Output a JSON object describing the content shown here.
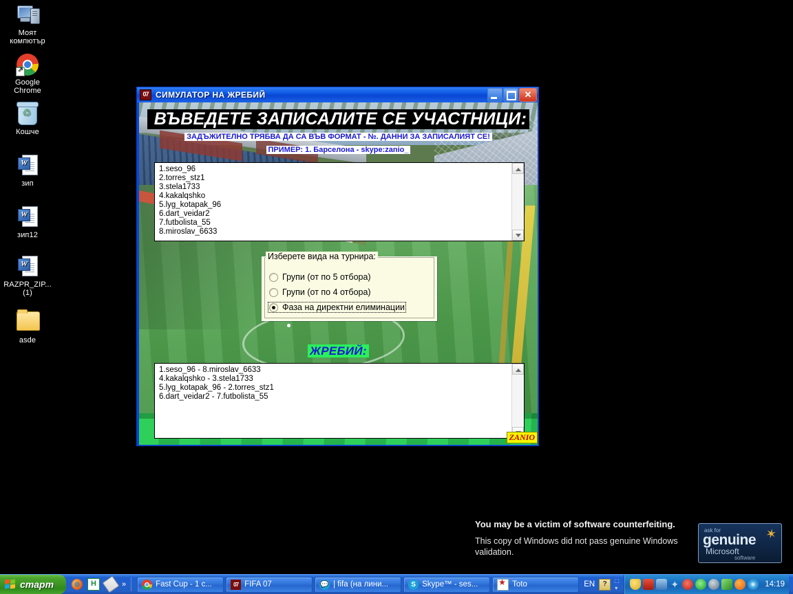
{
  "desktop": {
    "icons": [
      {
        "label": "Моят компютър",
        "icon": "my-computer-icon"
      },
      {
        "label": "Google Chrome",
        "icon": "chrome-icon"
      },
      {
        "label": "Кошче",
        "icon": "recycle-bin-icon"
      },
      {
        "label": "зип",
        "icon": "word-document-icon"
      },
      {
        "label": "зип12",
        "icon": "word-document-icon"
      },
      {
        "label": "RAZPR_ZIP... (1)",
        "icon": "word-document-icon"
      },
      {
        "label": "asde",
        "icon": "folder-icon"
      }
    ]
  },
  "wga": {
    "headline": "You may be a victim of software counterfeiting.",
    "body": "This copy of Windows did not pass genuine Windows validation.",
    "badge": {
      "ask_for": "ask for",
      "genuine": "genuine",
      "microsoft": "Microsoft",
      "software": "software"
    }
  },
  "window": {
    "title": "СИМУЛАТОР НА ЖРЕБИЙ",
    "icon_label": "07",
    "buttons": {
      "minimize": "minimize",
      "maximize": "maximize",
      "close": "✕"
    },
    "banner": {
      "heading": "ВЪВЕДЕТЕ ЗАПИСАЛИТЕ СЕ УЧАСТНИЦИ:",
      "subtitle": "ЗАДЪЖИТЕЛНО ТРЯБВА ДА СА ВЪВ ФОРМАТ - №. ДАННИ ЗА ЗАПИСАЛИЯТ СЕ!",
      "example": "ПРИМЕР: 1. Барселона - skype:zanio_"
    },
    "participants": [
      "1.seso_96",
      "2.torres_stz1",
      "3.stela1733",
      "4.kakalqshko",
      "5.lyg_kotapak_96",
      "6.dart_veidar2",
      "7.futbolista_55",
      "8.miroslav_6633"
    ],
    "tournament_group": {
      "legend": "Изберете вида на турнира:",
      "options": [
        {
          "label": "Групи (от по 5 отбора)",
          "selected": false
        },
        {
          "label": "Групи (от по 4 отбора)",
          "selected": false
        },
        {
          "label": "Фаза на директни елиминации",
          "selected": true
        }
      ]
    },
    "draw_label": "ЖРЕБИЙ:",
    "draw_results": [
      "1.seso_96 - 8.miroslav_6633",
      "4.kakalqshko - 3.stela1733",
      "5.lyg_kotapak_96 - 2.torres_stz1",
      "6.dart_veidar2 - 7.futbolista_55"
    ],
    "watermark": "ZANIO"
  },
  "taskbar": {
    "start": "старт",
    "quicklaunch": [
      {
        "name": "firefox-icon"
      },
      {
        "name": "green-h-icon"
      },
      {
        "name": "pencil-icon"
      }
    ],
    "overflow": "»",
    "tasks": [
      {
        "label": "Fast Cup - 1 c...",
        "icon": "chrome-icon"
      },
      {
        "label": "FIFA 07",
        "icon": "fifa-icon",
        "icon_label": "07"
      },
      {
        "label": "| fifa (на лини...",
        "icon": "skype-chat-icon"
      },
      {
        "label": "Skype™ - ses...",
        "icon": "skype-icon"
      },
      {
        "label": "Toto",
        "icon": "toto-icon"
      }
    ],
    "language": "EN",
    "lang_button": "?",
    "tray_icons": [
      "shield-warning-icon",
      "acrobat-icon",
      "network-icon",
      "star-icon",
      "block-icon",
      "flash-icon",
      "disc-icon",
      "paint-icon",
      "orange-circle-icon",
      "radar-icon"
    ],
    "clock": "14:19"
  }
}
